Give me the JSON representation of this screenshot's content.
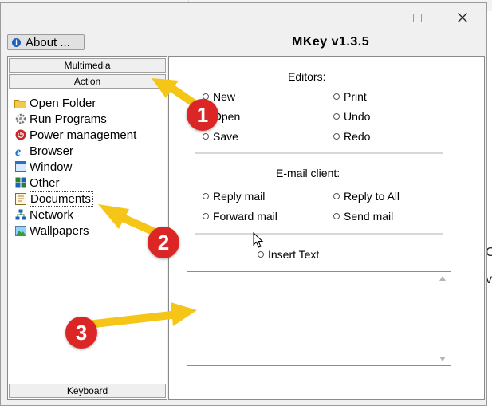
{
  "window": {
    "app_title": "MKey v1.3.5",
    "about_label": "About ...",
    "controls": [
      "minimize-icon",
      "maximize-icon",
      "close-icon"
    ]
  },
  "sidebar": {
    "categories_top": [
      "Multimedia",
      "Action"
    ],
    "category_bottom": "Keyboard",
    "items": [
      {
        "label": "Open Folder",
        "icon": "folder-icon"
      },
      {
        "label": "Run Programs",
        "icon": "gear-icon"
      },
      {
        "label": "Power management",
        "icon": "power-icon"
      },
      {
        "label": "Browser",
        "icon": "browser-icon"
      },
      {
        "label": "Window",
        "icon": "window-icon"
      },
      {
        "label": "Other",
        "icon": "other-icon"
      },
      {
        "label": "Documents",
        "icon": "document-icon",
        "selected": true
      },
      {
        "label": "Network",
        "icon": "network-icon"
      },
      {
        "label": "Wallpapers",
        "icon": "wallpaper-icon"
      }
    ]
  },
  "editors": {
    "title": "Editors:",
    "options": [
      "New",
      "Print",
      "Open",
      "Undo",
      "Save",
      "Redo"
    ]
  },
  "email": {
    "title": "E-mail client:",
    "options": [
      "Reply mail",
      "Reply to All",
      "Forward mail",
      "Send mail"
    ]
  },
  "insert_text": {
    "label": "Insert Text",
    "value": ""
  },
  "annotations": [
    {
      "number": "1"
    },
    {
      "number": "2"
    },
    {
      "number": "3"
    }
  ],
  "stray": {
    "line1": "O",
    "line2": "v"
  },
  "colors": {
    "annotation_arrow": "#f5c518",
    "badge": "#dc2626",
    "window_bg": "#f0f0f0"
  }
}
